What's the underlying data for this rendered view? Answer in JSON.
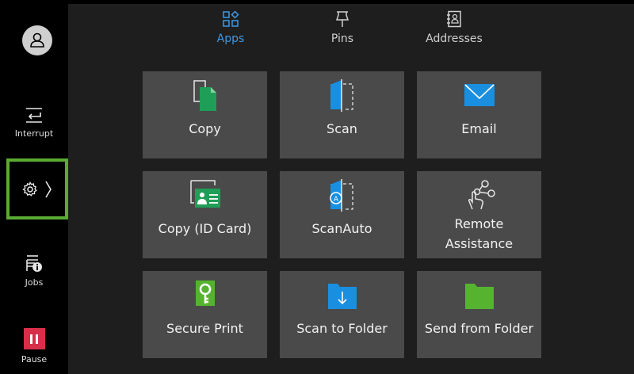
{
  "rail": {
    "interrupt_label": "Interrupt",
    "jobs_label": "Jobs",
    "pause_label": "Pause"
  },
  "tabs": [
    {
      "label": "Apps",
      "icon": "apps-grid-icon",
      "active": true
    },
    {
      "label": "Pins",
      "icon": "pin-icon",
      "active": false
    },
    {
      "label": "Addresses",
      "icon": "address-book-icon",
      "active": false
    }
  ],
  "tiles": [
    {
      "label": "Copy",
      "icon": "copy-icon"
    },
    {
      "label": "Scan",
      "icon": "scan-icon"
    },
    {
      "label": "Email",
      "icon": "email-icon"
    },
    {
      "label": "Copy (ID Card)",
      "icon": "id-card-copy-icon"
    },
    {
      "label": "ScanAuto",
      "icon": "scan-auto-icon"
    },
    {
      "label": "Remote Assistance",
      "icon": "remote-assistance-icon"
    },
    {
      "label": "Secure Print",
      "icon": "secure-print-icon"
    },
    {
      "label": "Scan to Folder",
      "icon": "scan-to-folder-icon"
    },
    {
      "label": "Send from Folder",
      "icon": "send-from-folder-icon"
    }
  ],
  "colors": {
    "accent_blue": "#1a8fe0",
    "accent_green": "#56b330",
    "highlight_green": "#5aaa33",
    "pause_red": "#d82e4a",
    "tile_bg": "#4a4a4a",
    "main_bg": "#1e1e1e"
  }
}
